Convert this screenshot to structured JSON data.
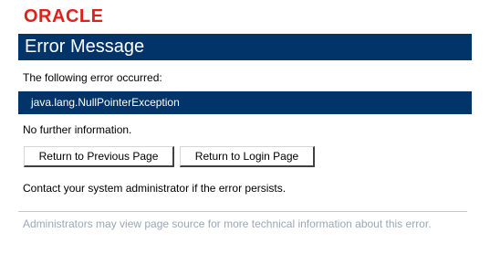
{
  "logo": {
    "text": "ORACLE"
  },
  "title": "Error Message",
  "intro_text": "The following error occurred:",
  "exception": "java.lang.NullPointerException",
  "details": "No further information.",
  "buttons": {
    "previous": "Return to Previous Page",
    "login": "Return to Login Page"
  },
  "contact_text": "Contact your system administrator if the error persists.",
  "admin_note": "Administrators may view page source for more technical information about this error.",
  "colors": {
    "brand_red": "#e0211b",
    "header_navy": "#02346a",
    "muted_text": "#9aa7b6"
  }
}
